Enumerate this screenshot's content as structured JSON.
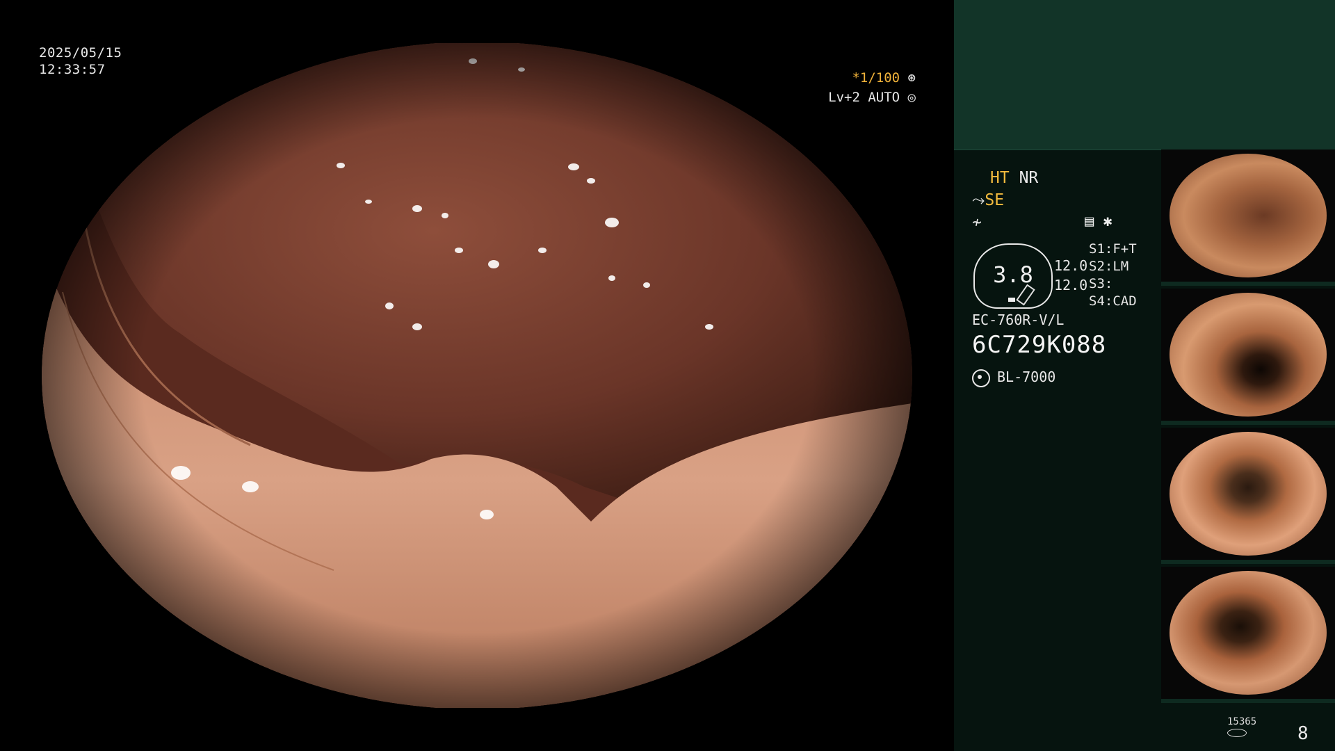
{
  "overlay": {
    "date": "2025/05/15",
    "time": "12:33:57",
    "shutter": "*1/100",
    "level": "Lv+2 AUTO"
  },
  "panel": {
    "ht": "HT",
    "nr": "NR",
    "se": "SE",
    "gauge_value": "3.8",
    "num1": "12.0",
    "num2": "12.0",
    "s1": "S1:F+T",
    "s2": "S2:LM",
    "s3": "S3:",
    "s4": "S4:CAD",
    "model": "EC-760R-V/L",
    "serial": "6C729K088",
    "lamp": "BL-7000",
    "counter": "15365",
    "page": "8"
  },
  "colors": {
    "panel_bg": "#06140f",
    "panel_top": "#123428",
    "amber": "#f3bb3e"
  }
}
